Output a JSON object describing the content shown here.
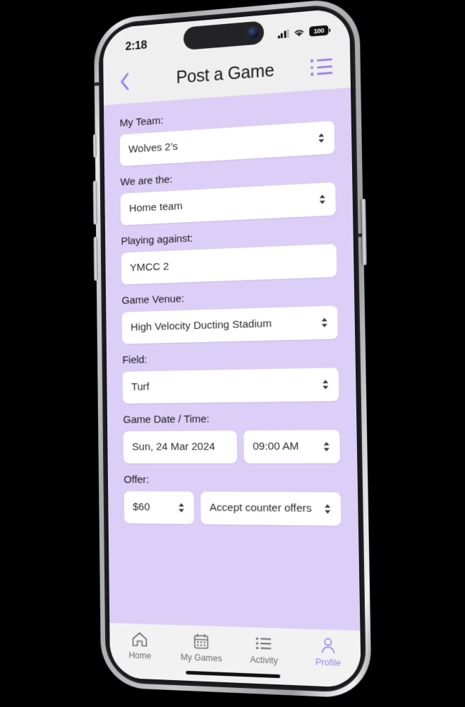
{
  "status_bar": {
    "time": "2:18",
    "battery_level": "100",
    "signal_icon": "cellular-signal-icon",
    "wifi_icon": "wifi-icon",
    "battery_icon": "battery-icon"
  },
  "nav": {
    "back_icon": "chevron-left-icon",
    "title": "Post a Game",
    "menu_icon": "bulleted-list-icon"
  },
  "theme": {
    "accent": "#9b87e8",
    "body_background": "#DCCFF7",
    "chrome_background": "#EFEFEF",
    "control_background": "#FFFFFF",
    "text": "#1c1c1c",
    "muted_text": "#6e6e70"
  },
  "form": {
    "fields": [
      {
        "label": "My Team:",
        "name": "my-team",
        "control": "select",
        "value": "Wolves 2’s"
      },
      {
        "label": "We are the:",
        "name": "we-are-the",
        "control": "select",
        "value": "Home team"
      },
      {
        "label": "Playing against:",
        "name": "playing-against",
        "control": "text",
        "value": "YMCC 2"
      },
      {
        "label": "Game Venue:",
        "name": "game-venue",
        "control": "select",
        "value": "High Velocity Ducting Stadium"
      },
      {
        "label": "Field:",
        "name": "field",
        "control": "select",
        "value": "Turf"
      }
    ],
    "date_time": {
      "label": "Game Date / Time:",
      "date_value": "Sun, 24 Mar 2024",
      "time_value": "09:00 AM"
    },
    "offer": {
      "label": "Offer:",
      "price_value": "$60",
      "counter_value": "Accept counter offers"
    }
  },
  "tab_bar": {
    "items": [
      {
        "label": "Home",
        "icon": "home-icon",
        "active": false
      },
      {
        "label": "My Games",
        "icon": "calendar-icon",
        "active": false
      },
      {
        "label": "Activity",
        "icon": "list-icon",
        "active": false
      },
      {
        "label": "Profile",
        "icon": "person-icon",
        "active": true
      }
    ]
  }
}
